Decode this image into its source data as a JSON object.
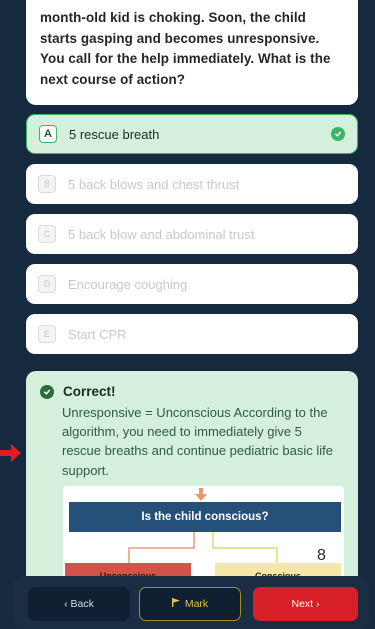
{
  "question": {
    "text": "month-old kid is choking. Soon, the child starts gasping and becomes unresponsive. You call for the help immediately. What is the next course of action?"
  },
  "options": [
    {
      "letter": "A",
      "label": "5 rescue breath",
      "selected": true
    },
    {
      "letter": "B",
      "label": "5 back blows and chest thrust",
      "selected": false
    },
    {
      "letter": "C",
      "label": "5 back blow and abdominal trust",
      "selected": false
    },
    {
      "letter": "D",
      "label": "Encourage coughing",
      "selected": false
    },
    {
      "letter": "E",
      "label": "Start CPR",
      "selected": false
    }
  ],
  "feedback": {
    "title": "Correct!",
    "body": "Unresponsive = Unconscious According to the algorithm, you need to immediately give 5 rescue breaths and continue pediatric basic life support."
  },
  "flowchart": {
    "title": "Is the child conscious?",
    "page_number": "8",
    "left_label": "Unconscious",
    "right_label": "Conscious"
  },
  "footer": {
    "back_label": "‹ Back",
    "mark_label": "Mark",
    "next_label": "Next ›"
  },
  "colors": {
    "background": "#162a3f",
    "correct_bg": "#d4efdc",
    "correct_accent": "#3bb56a",
    "next_button": "#d61f26",
    "mark_accent": "#e3c14f"
  },
  "icons": {
    "check": "check-circle-icon",
    "flag": "flag-icon",
    "arrow": "arrow-right-icon"
  }
}
